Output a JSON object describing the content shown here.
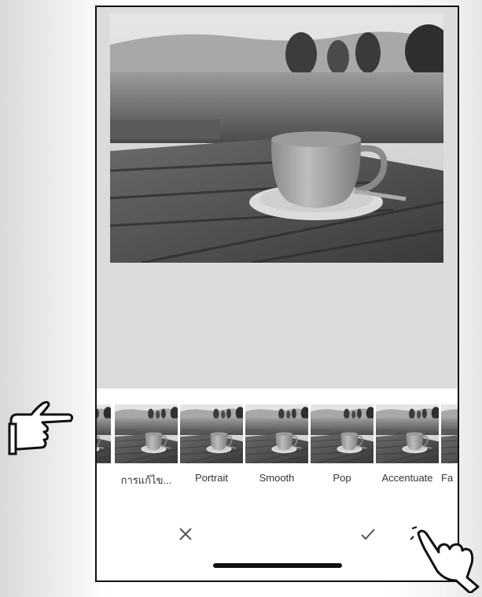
{
  "editor": {
    "filters": [
      {
        "label": ""
      },
      {
        "label": "การแก้ไข..."
      },
      {
        "label": "Portrait"
      },
      {
        "label": "Smooth"
      },
      {
        "label": "Pop"
      },
      {
        "label": "Accentuate"
      },
      {
        "label": "Fa"
      }
    ]
  },
  "actions": {
    "cancel_icon": "close-icon",
    "confirm_icon": "check-icon"
  }
}
